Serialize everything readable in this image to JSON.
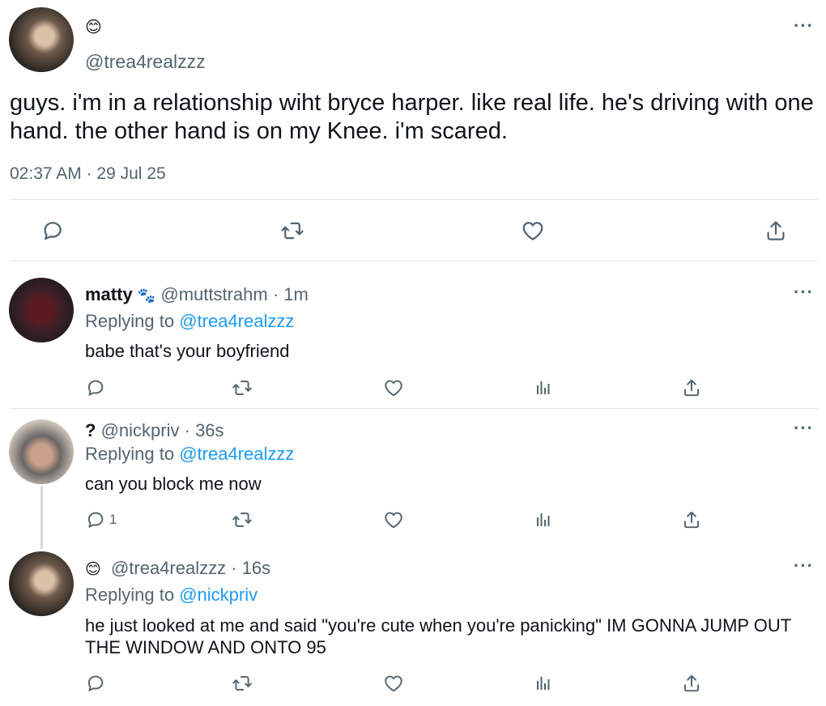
{
  "main_tweet": {
    "display_name_emoji": "😊",
    "handle": "@trea4realzzz",
    "text": "guys. i'm in a relationship wiht bryce harper. like real life. he's driving with one hand. the other hand is on my Knee. i'm scared.",
    "timestamp": "02:37 AM · 29 Jul 25",
    "more_label": "···"
  },
  "replies": [
    {
      "name": "matty",
      "name_emoji": "🐾",
      "handle": "@muttstrahm",
      "separator": "·",
      "time": "1m",
      "replying_prefix": "Replying to",
      "replying_to": "@trea4realzzz",
      "text": "babe that's your boyfriend",
      "reply_count": "",
      "more_label": "···"
    },
    {
      "name": "?",
      "name_emoji": "",
      "handle": "@nickpriv",
      "separator": "·",
      "time": "36s",
      "replying_prefix": "Replying to",
      "replying_to": "@trea4realzzz",
      "text": "can you block me now",
      "reply_count": "1",
      "more_label": "···"
    },
    {
      "name": "",
      "name_emoji": "😊",
      "handle": "@trea4realzzz",
      "separator": "·",
      "time": "16s",
      "replying_prefix": "Replying to",
      "replying_to": "@nickpriv",
      "text": "he just looked at me and said \"you're cute when you're panicking\" IM GONNA JUMP OUT THE WINDOW AND ONTO 95",
      "reply_count": "",
      "more_label": "···"
    }
  ],
  "icons": [
    "reply-icon",
    "retweet-icon",
    "like-icon",
    "analytics-icon",
    "share-icon"
  ],
  "colors": {
    "text": "#0f1419",
    "secondary": "#536471",
    "link": "#1d9bf0",
    "divider": "#e3e6e8"
  }
}
